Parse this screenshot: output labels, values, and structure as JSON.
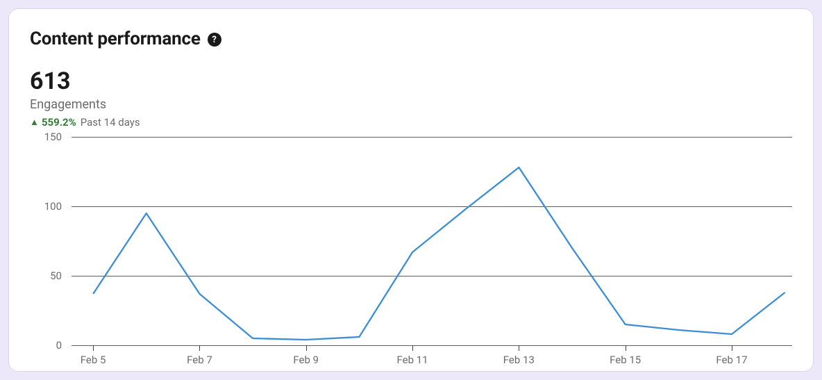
{
  "card": {
    "title": "Content performance",
    "help_icon_label": "?"
  },
  "metric": {
    "value": "613",
    "label": "Engagements",
    "delta_arrow": "▲",
    "delta_pct": "559.2%",
    "delta_period": "Past 14 days"
  },
  "chart_data": {
    "type": "line",
    "title": "",
    "xlabel": "",
    "ylabel": "",
    "ylim": [
      0,
      150
    ],
    "y_ticks": [
      0,
      50,
      100,
      150
    ],
    "categories": [
      "Feb 5",
      "Feb 6",
      "Feb 7",
      "Feb 8",
      "Feb 9",
      "Feb 10",
      "Feb 11",
      "Feb 12",
      "Feb 13",
      "Feb 14",
      "Feb 15",
      "Feb 16",
      "Feb 17",
      "Feb 18"
    ],
    "x_tick_labels": [
      "Feb 5",
      "Feb 7",
      "Feb 9",
      "Feb 11",
      "Feb 13",
      "Feb 15",
      "Feb 17"
    ],
    "values": [
      37,
      95,
      37,
      5,
      4,
      6,
      67,
      98,
      128,
      70,
      15,
      11,
      8,
      38
    ],
    "line_color": "#3b8ed6"
  }
}
